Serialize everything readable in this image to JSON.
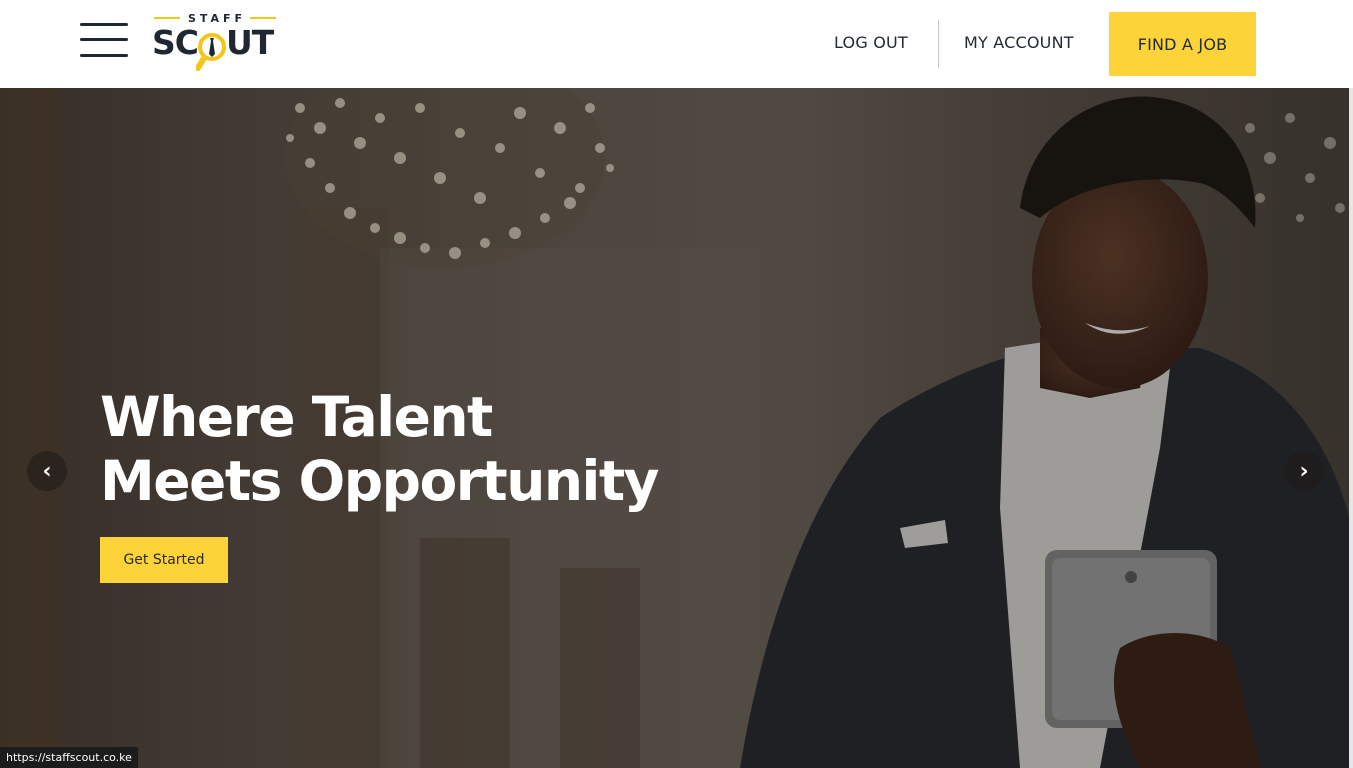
{
  "header": {
    "logo": {
      "small_text": "STAFF",
      "word_left": "SC",
      "word_right": "UT",
      "magnifier_icon": "magnifier-tie-icon"
    },
    "menu_icon": "hamburger-menu-icon",
    "nav": {
      "logout_label": "LOG OUT",
      "account_label": "MY ACCOUNT",
      "find_job_label": "FIND A JOB"
    }
  },
  "hero": {
    "headline_line1": "Where Talent",
    "headline_line2": "Meets Opportunity",
    "cta_label": "Get Started",
    "prev_arrow": "‹",
    "next_arrow": "›",
    "image": "man-in-suit-holding-tablet-photo"
  },
  "status_bar": {
    "url": "https://staffscout.co.ke"
  },
  "colors": {
    "accent": "#fdd33a",
    "dark": "#1f2733",
    "white": "#ffffff"
  }
}
